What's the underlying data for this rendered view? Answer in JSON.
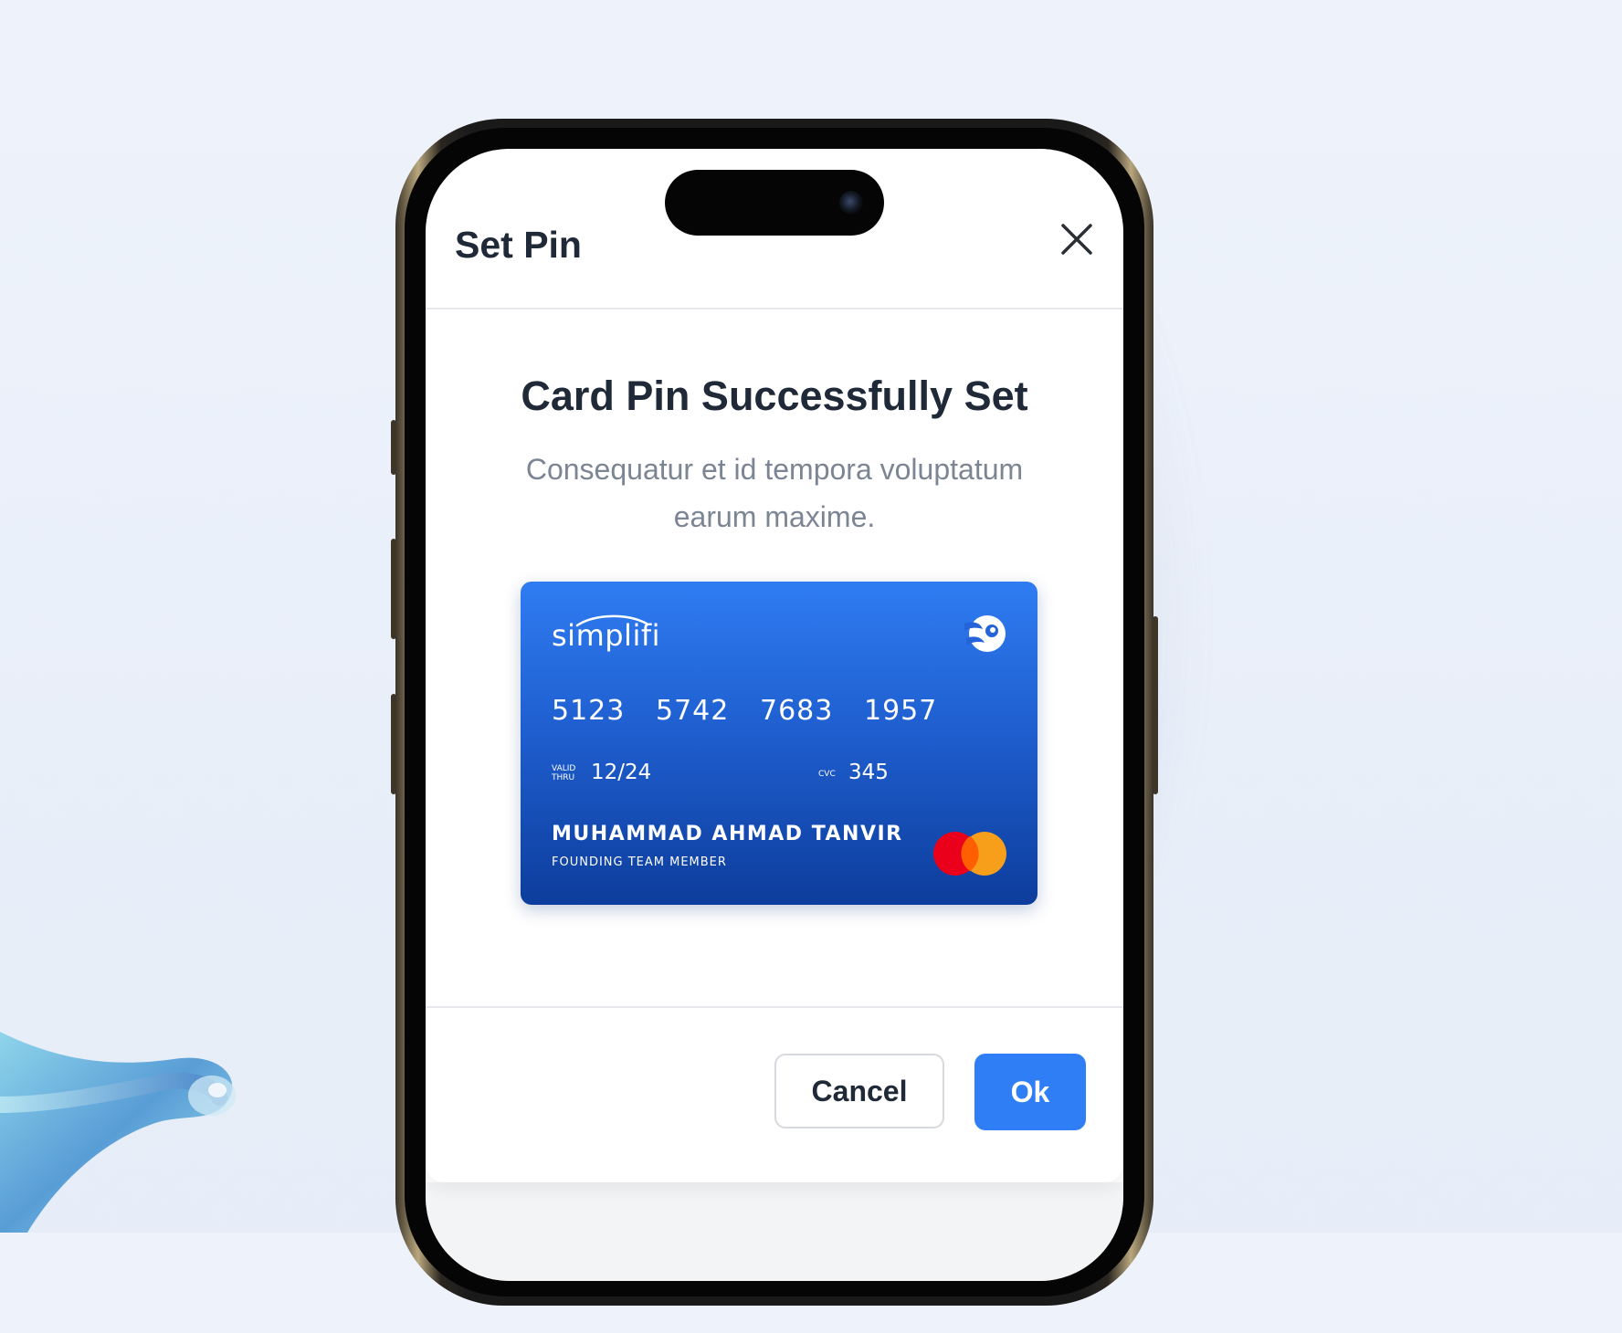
{
  "modal": {
    "title": "Set Pin",
    "close_icon": "close-icon",
    "heading": "Card Pin Successfully Set",
    "description": "Consequatur et id tempora voluptatum earum maxime."
  },
  "card": {
    "brand": "simplifi",
    "number_groups": [
      "5123",
      "5742",
      "7683",
      "1957"
    ],
    "valid_label_line1": "VALID",
    "valid_label_line2": "THRU",
    "valid_thru": "12/24",
    "cvc_label": "CVC",
    "cvc": "345",
    "holder_name": "MUHAMMAD AHMAD TANVIR",
    "holder_role": "FOUNDING TEAM MEMBER",
    "network_icon": "mastercard-icon",
    "colors": {
      "top": "#2f7cf2",
      "bottom": "#0d3d9c"
    }
  },
  "actions": {
    "cancel_label": "Cancel",
    "ok_label": "Ok"
  },
  "colors": {
    "accent": "#2f7ef5",
    "text_primary": "#1f2937",
    "text_secondary": "#7c8593",
    "background": "#eef3fb"
  }
}
